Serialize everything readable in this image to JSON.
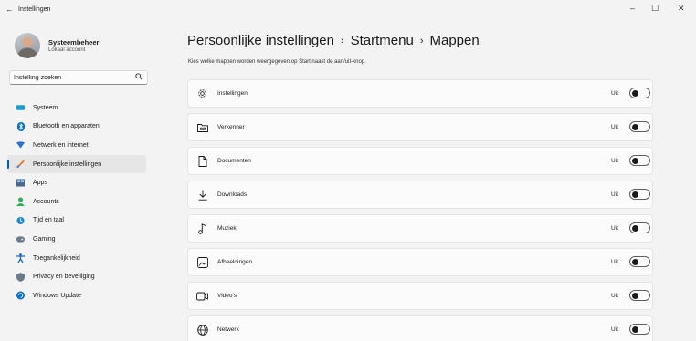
{
  "window": {
    "back_glyph": "←",
    "title": "Instellingen",
    "min_glyph": "–",
    "max_glyph": "☐",
    "close_glyph": "✕"
  },
  "user": {
    "name": "Systeembeheer",
    "account_type": "Lokaal account"
  },
  "search": {
    "value": "Instelling zoeken",
    "icon": "search-icon"
  },
  "sidebar": {
    "items": [
      {
        "label": "Systeem",
        "icon": "system-icon",
        "color": "#1c9ad6",
        "active": false
      },
      {
        "label": "Bluetooth en apparaten",
        "icon": "bluetooth-icon",
        "color": "#0a6fd1",
        "active": false
      },
      {
        "label": "Netwerk en internet",
        "icon": "network-icon",
        "color": "#2b6fd6",
        "active": false
      },
      {
        "label": "Persoonlijke instellingen",
        "icon": "personalization-icon",
        "color": "#e07a1f",
        "active": true
      },
      {
        "label": "Apps",
        "icon": "apps-icon",
        "color": "#4a6a8a",
        "active": false
      },
      {
        "label": "Accounts",
        "icon": "accounts-icon",
        "color": "#2fae5a",
        "active": false
      },
      {
        "label": "Tijd en taal",
        "icon": "time-language-icon",
        "color": "#1f8ad6",
        "active": false
      },
      {
        "label": "Gaming",
        "icon": "gaming-icon",
        "color": "#6b7b8c",
        "active": false
      },
      {
        "label": "Toegankelijkheid",
        "icon": "accessibility-icon",
        "color": "#1763c6",
        "active": false
      },
      {
        "label": "Privacy en beveiliging",
        "icon": "privacy-shield-icon",
        "color": "#6b7b8c",
        "active": false
      },
      {
        "label": "Windows Update",
        "icon": "windows-update-icon",
        "color": "#0a6fd1",
        "active": false
      }
    ]
  },
  "breadcrumb": {
    "part1": "Persoonlijke instellingen",
    "part2": "Startmenu",
    "part3": "Mappen",
    "separator": "›"
  },
  "description": "Kies welke mappen worden weergegeven op Start naast de aan/uit-knop.",
  "folders": [
    {
      "label": "Instellingen",
      "icon": "settings-gear-icon",
      "glyph": "⚙",
      "state": "Uit"
    },
    {
      "label": "Verkenner",
      "icon": "file-explorer-icon",
      "glyph": "🗀",
      "state": "Uit"
    },
    {
      "label": "Documenten",
      "icon": "document-icon",
      "glyph": "🗋",
      "state": "Uit"
    },
    {
      "label": "Downloads",
      "icon": "download-icon",
      "glyph": "⤓",
      "state": "Uit"
    },
    {
      "label": "Muziek",
      "icon": "music-icon",
      "glyph": "♪",
      "state": "Uit"
    },
    {
      "label": "Afbeeldingen",
      "icon": "pictures-icon",
      "glyph": "🖼",
      "state": "Uit"
    },
    {
      "label": "Video's",
      "icon": "video-icon",
      "glyph": "▭",
      "state": "Uit"
    },
    {
      "label": "Netwerk",
      "icon": "network-globe-icon",
      "glyph": "🌐",
      "state": "Uit"
    }
  ]
}
